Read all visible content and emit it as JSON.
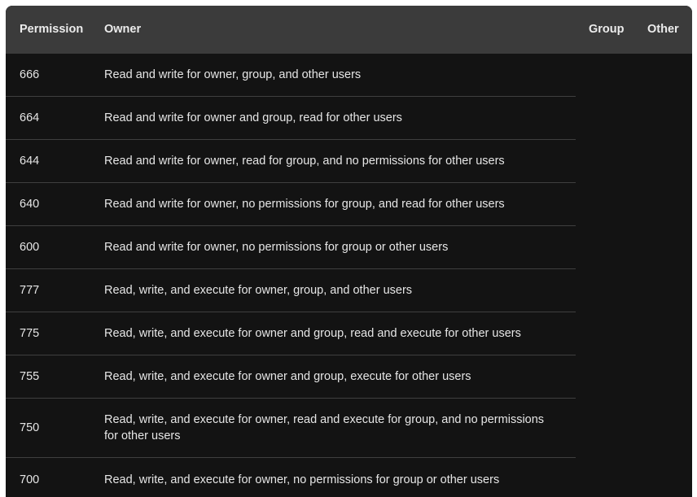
{
  "table": {
    "headers": {
      "permission": "Permission",
      "owner": "Owner",
      "group": "Group",
      "other": "Other"
    },
    "rows": [
      {
        "code": "666",
        "description": "Read and write for owner, group, and other users"
      },
      {
        "code": "664",
        "description": "Read and write for owner and group, read for other users"
      },
      {
        "code": "644",
        "description": "Read and write for owner, read for group, and no permissions for other users"
      },
      {
        "code": "640",
        "description": "Read and write for owner, no permissions for group, and read for other users"
      },
      {
        "code": "600",
        "description": "Read and write for owner, no permissions for group or other users"
      },
      {
        "code": "777",
        "description": "Read, write, and execute for owner, group, and other users"
      },
      {
        "code": "775",
        "description": "Read, write, and execute for owner and group, read and execute for other users"
      },
      {
        "code": "755",
        "description": "Read, write, and execute for owner and group, execute for other users"
      },
      {
        "code": "750",
        "description": "Read, write, and execute for owner, read and execute for group, and no permissions for other users"
      },
      {
        "code": "700",
        "description": "Read, write, and execute for owner, no permissions for group or other users"
      }
    ]
  }
}
